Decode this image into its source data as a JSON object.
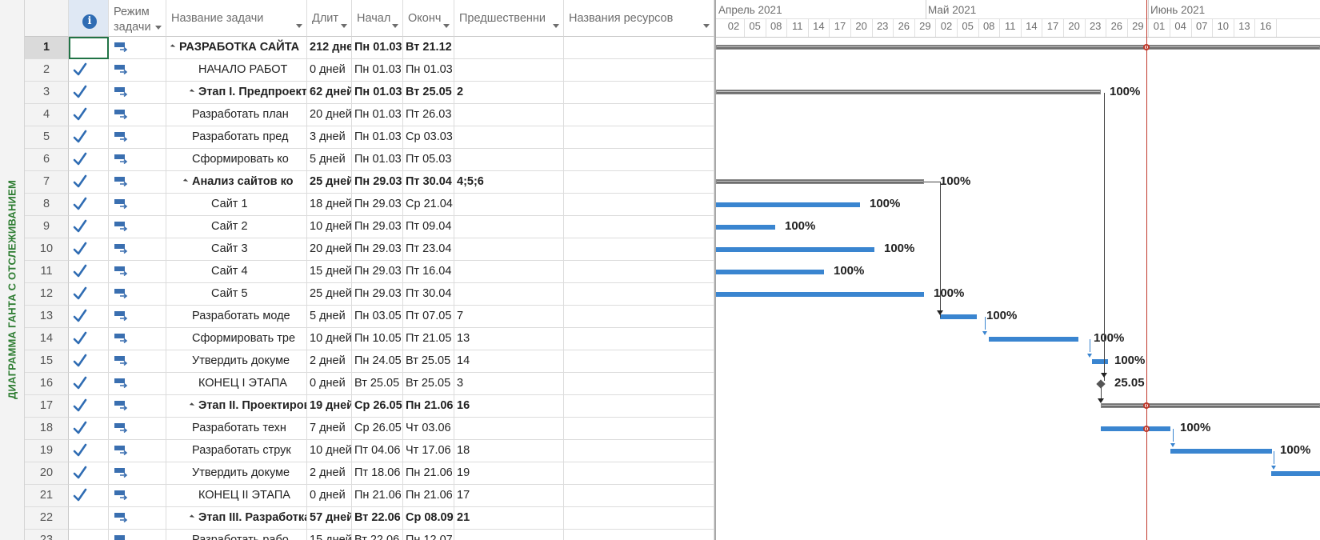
{
  "side_label": "ДИАГРАММА ГАНТА С ОТСЛЕЖИВАНИЕМ",
  "columns": {
    "mode": "Режим задачи",
    "name": "Название задачи",
    "duration": "Длит",
    "start": "Начал",
    "finish": "Оконч",
    "predecessors": "Предшественни",
    "resources": "Названия ресурсов"
  },
  "timeline": {
    "months": [
      "Апрель 2021",
      "Май 2021",
      "Июнь 2021"
    ],
    "days": [
      "02",
      "05",
      "08",
      "11",
      "14",
      "17",
      "20",
      "23",
      "26",
      "29",
      "02",
      "05",
      "08",
      "11",
      "14",
      "17",
      "20",
      "23",
      "26",
      "29",
      "01",
      "04",
      "07",
      "10",
      "13",
      "16"
    ]
  },
  "tasks": [
    {
      "id": "1",
      "name": "РАЗРАБОТКА САЙТА",
      "duration": "212 дне",
      "start": "Пн 01.03",
      "finish": "Вт 21.12",
      "pred": "",
      "level": 0,
      "summary": true,
      "done": false
    },
    {
      "id": "2",
      "name": "НАЧАЛО РАБОТ",
      "duration": "0 дней",
      "start": "Пн 01.03",
      "finish": "Пн 01.03",
      "pred": "",
      "level": 1,
      "summary": false,
      "done": true
    },
    {
      "id": "3",
      "name": "Этап I. Предпроекти",
      "duration": "62 дней",
      "start": "Пн 01.03",
      "finish": "Вт 25.05",
      "pred": "2",
      "level": 1,
      "summary": true,
      "done": true
    },
    {
      "id": "4",
      "name": "Разработать план",
      "duration": "20 дней",
      "start": "Пн 01.03",
      "finish": "Пт 26.03",
      "pred": "",
      "level": 2,
      "summary": false,
      "done": true
    },
    {
      "id": "5",
      "name": "Разработать пред",
      "duration": "3 дней",
      "start": "Пн 01.03",
      "finish": "Ср 03.03",
      "pred": "",
      "level": 2,
      "summary": false,
      "done": true
    },
    {
      "id": "6",
      "name": "Сформировать ко",
      "duration": "5 дней",
      "start": "Пн 01.03",
      "finish": "Пт 05.03",
      "pred": "",
      "level": 2,
      "summary": false,
      "done": true
    },
    {
      "id": "7",
      "name": "Анализ сайтов ко",
      "duration": "25 дней",
      "start": "Пн 29.03",
      "finish": "Пт 30.04",
      "pred": "4;5;6",
      "level": 2,
      "summary": true,
      "done": true
    },
    {
      "id": "8",
      "name": "Сайт 1",
      "duration": "18 дней",
      "start": "Пн 29.03",
      "finish": "Ср 21.04",
      "pred": "",
      "level": 3,
      "summary": false,
      "done": true
    },
    {
      "id": "9",
      "name": "Сайт 2",
      "duration": "10 дней",
      "start": "Пн 29.03",
      "finish": "Пт 09.04",
      "pred": "",
      "level": 3,
      "summary": false,
      "done": true
    },
    {
      "id": "10",
      "name": "Сайт 3",
      "duration": "20 дней",
      "start": "Пн 29.03",
      "finish": "Пт 23.04",
      "pred": "",
      "level": 3,
      "summary": false,
      "done": true
    },
    {
      "id": "11",
      "name": "Сайт 4",
      "duration": "15 дней",
      "start": "Пн 29.03",
      "finish": "Пт 16.04",
      "pred": "",
      "level": 3,
      "summary": false,
      "done": true
    },
    {
      "id": "12",
      "name": "Сайт 5",
      "duration": "25 дней",
      "start": "Пн 29.03",
      "finish": "Пт 30.04",
      "pred": "",
      "level": 3,
      "summary": false,
      "done": true
    },
    {
      "id": "13",
      "name": "Разработать моде",
      "duration": "5 дней",
      "start": "Пн 03.05",
      "finish": "Пт 07.05",
      "pred": "7",
      "level": 2,
      "summary": false,
      "done": true
    },
    {
      "id": "14",
      "name": "Сформировать тре",
      "duration": "10 дней",
      "start": "Пн 10.05",
      "finish": "Пт 21.05",
      "pred": "13",
      "level": 2,
      "summary": false,
      "done": true
    },
    {
      "id": "15",
      "name": "Утвердить докуме",
      "duration": "2 дней",
      "start": "Пн 24.05",
      "finish": "Вт 25.05",
      "pred": "14",
      "level": 2,
      "summary": false,
      "done": true
    },
    {
      "id": "16",
      "name": "КОНЕЦ I ЭТАПА",
      "duration": "0 дней",
      "start": "Вт 25.05",
      "finish": "Вт 25.05",
      "pred": "3",
      "level": 1,
      "summary": false,
      "done": true
    },
    {
      "id": "17",
      "name": "Этап II. Проектиров",
      "duration": "19 дней",
      "start": "Ср 26.05",
      "finish": "Пн 21.06",
      "pred": "16",
      "level": 1,
      "summary": true,
      "done": true
    },
    {
      "id": "18",
      "name": "Разработать техн",
      "duration": "7 дней",
      "start": "Ср 26.05",
      "finish": "Чт 03.06",
      "pred": "",
      "level": 2,
      "summary": false,
      "done": true
    },
    {
      "id": "19",
      "name": "Разработать струк",
      "duration": "10 дней",
      "start": "Пт 04.06",
      "finish": "Чт 17.06",
      "pred": "18",
      "level": 2,
      "summary": false,
      "done": true
    },
    {
      "id": "20",
      "name": "Утвердить докуме",
      "duration": "2 дней",
      "start": "Пт 18.06",
      "finish": "Пн 21.06",
      "pred": "19",
      "level": 2,
      "summary": false,
      "done": true
    },
    {
      "id": "21",
      "name": "КОНЕЦ II ЭТАПА",
      "duration": "0 дней",
      "start": "Пн 21.06",
      "finish": "Пн 21.06",
      "pred": "17",
      "level": 1,
      "summary": false,
      "done": true
    },
    {
      "id": "22",
      "name": "Этап III. Разработка",
      "duration": "57 дней",
      "start": "Вт 22.06",
      "finish": "Ср 08.09",
      "pred": "21",
      "level": 1,
      "summary": true,
      "done": false
    },
    {
      "id": "23",
      "name": "Разработать рабо",
      "duration": "15 дней",
      "start": "Вт 22.06",
      "finish": "Пн 12.07",
      "pred": "",
      "level": 2,
      "summary": false,
      "done": false
    }
  ],
  "gantt_labels": [
    {
      "row": 3,
      "text": "100%"
    },
    {
      "row": 7,
      "text": "100%"
    },
    {
      "row": 8,
      "text": "100%"
    },
    {
      "row": 9,
      "text": "100%"
    },
    {
      "row": 10,
      "text": "100%"
    },
    {
      "row": 11,
      "text": "100%"
    },
    {
      "row": 12,
      "text": "100%"
    },
    {
      "row": 13,
      "text": "100%"
    },
    {
      "row": 14,
      "text": "100%"
    },
    {
      "row": 15,
      "text": "100%"
    },
    {
      "row": 16,
      "text": "25.05"
    },
    {
      "row": 18,
      "text": "100%"
    },
    {
      "row": 19,
      "text": "100%"
    }
  ]
}
